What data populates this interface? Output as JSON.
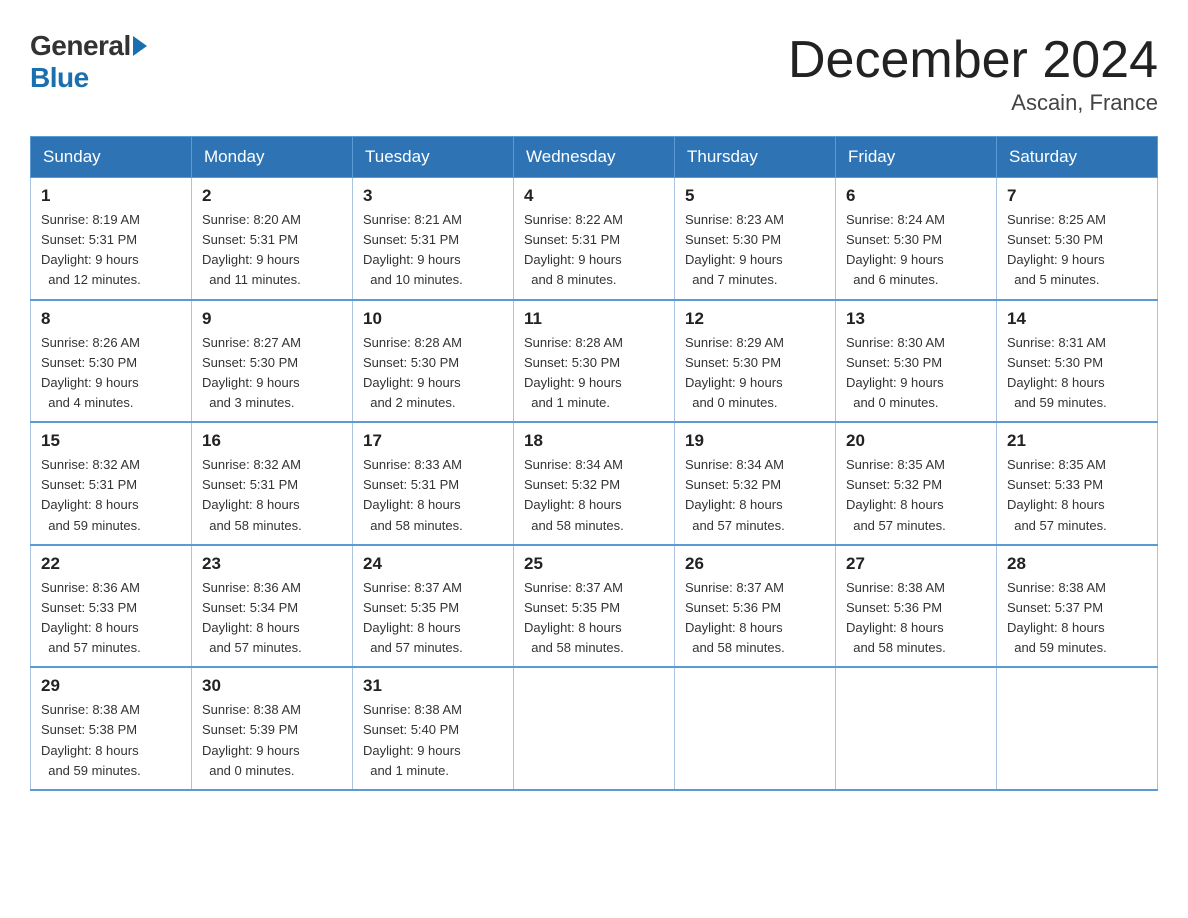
{
  "header": {
    "title": "December 2024",
    "subtitle": "Ascain, France",
    "logo_general": "General",
    "logo_blue": "Blue"
  },
  "days_of_week": [
    "Sunday",
    "Monday",
    "Tuesday",
    "Wednesday",
    "Thursday",
    "Friday",
    "Saturday"
  ],
  "weeks": [
    [
      {
        "day": "1",
        "sunrise": "8:19 AM",
        "sunset": "5:31 PM",
        "daylight": "9 hours and 12 minutes."
      },
      {
        "day": "2",
        "sunrise": "8:20 AM",
        "sunset": "5:31 PM",
        "daylight": "9 hours and 11 minutes."
      },
      {
        "day": "3",
        "sunrise": "8:21 AM",
        "sunset": "5:31 PM",
        "daylight": "9 hours and 10 minutes."
      },
      {
        "day": "4",
        "sunrise": "8:22 AM",
        "sunset": "5:31 PM",
        "daylight": "9 hours and 8 minutes."
      },
      {
        "day": "5",
        "sunrise": "8:23 AM",
        "sunset": "5:30 PM",
        "daylight": "9 hours and 7 minutes."
      },
      {
        "day": "6",
        "sunrise": "8:24 AM",
        "sunset": "5:30 PM",
        "daylight": "9 hours and 6 minutes."
      },
      {
        "day": "7",
        "sunrise": "8:25 AM",
        "sunset": "5:30 PM",
        "daylight": "9 hours and 5 minutes."
      }
    ],
    [
      {
        "day": "8",
        "sunrise": "8:26 AM",
        "sunset": "5:30 PM",
        "daylight": "9 hours and 4 minutes."
      },
      {
        "day": "9",
        "sunrise": "8:27 AM",
        "sunset": "5:30 PM",
        "daylight": "9 hours and 3 minutes."
      },
      {
        "day": "10",
        "sunrise": "8:28 AM",
        "sunset": "5:30 PM",
        "daylight": "9 hours and 2 minutes."
      },
      {
        "day": "11",
        "sunrise": "8:28 AM",
        "sunset": "5:30 PM",
        "daylight": "9 hours and 1 minute."
      },
      {
        "day": "12",
        "sunrise": "8:29 AM",
        "sunset": "5:30 PM",
        "daylight": "9 hours and 0 minutes."
      },
      {
        "day": "13",
        "sunrise": "8:30 AM",
        "sunset": "5:30 PM",
        "daylight": "9 hours and 0 minutes."
      },
      {
        "day": "14",
        "sunrise": "8:31 AM",
        "sunset": "5:30 PM",
        "daylight": "8 hours and 59 minutes."
      }
    ],
    [
      {
        "day": "15",
        "sunrise": "8:32 AM",
        "sunset": "5:31 PM",
        "daylight": "8 hours and 59 minutes."
      },
      {
        "day": "16",
        "sunrise": "8:32 AM",
        "sunset": "5:31 PM",
        "daylight": "8 hours and 58 minutes."
      },
      {
        "day": "17",
        "sunrise": "8:33 AM",
        "sunset": "5:31 PM",
        "daylight": "8 hours and 58 minutes."
      },
      {
        "day": "18",
        "sunrise": "8:34 AM",
        "sunset": "5:32 PM",
        "daylight": "8 hours and 58 minutes."
      },
      {
        "day": "19",
        "sunrise": "8:34 AM",
        "sunset": "5:32 PM",
        "daylight": "8 hours and 57 minutes."
      },
      {
        "day": "20",
        "sunrise": "8:35 AM",
        "sunset": "5:32 PM",
        "daylight": "8 hours and 57 minutes."
      },
      {
        "day": "21",
        "sunrise": "8:35 AM",
        "sunset": "5:33 PM",
        "daylight": "8 hours and 57 minutes."
      }
    ],
    [
      {
        "day": "22",
        "sunrise": "8:36 AM",
        "sunset": "5:33 PM",
        "daylight": "8 hours and 57 minutes."
      },
      {
        "day": "23",
        "sunrise": "8:36 AM",
        "sunset": "5:34 PM",
        "daylight": "8 hours and 57 minutes."
      },
      {
        "day": "24",
        "sunrise": "8:37 AM",
        "sunset": "5:35 PM",
        "daylight": "8 hours and 57 minutes."
      },
      {
        "day": "25",
        "sunrise": "8:37 AM",
        "sunset": "5:35 PM",
        "daylight": "8 hours and 58 minutes."
      },
      {
        "day": "26",
        "sunrise": "8:37 AM",
        "sunset": "5:36 PM",
        "daylight": "8 hours and 58 minutes."
      },
      {
        "day": "27",
        "sunrise": "8:38 AM",
        "sunset": "5:36 PM",
        "daylight": "8 hours and 58 minutes."
      },
      {
        "day": "28",
        "sunrise": "8:38 AM",
        "sunset": "5:37 PM",
        "daylight": "8 hours and 59 minutes."
      }
    ],
    [
      {
        "day": "29",
        "sunrise": "8:38 AM",
        "sunset": "5:38 PM",
        "daylight": "8 hours and 59 minutes."
      },
      {
        "day": "30",
        "sunrise": "8:38 AM",
        "sunset": "5:39 PM",
        "daylight": "9 hours and 0 minutes."
      },
      {
        "day": "31",
        "sunrise": "8:38 AM",
        "sunset": "5:40 PM",
        "daylight": "9 hours and 1 minute."
      },
      null,
      null,
      null,
      null
    ]
  ],
  "labels": {
    "sunrise": "Sunrise:",
    "sunset": "Sunset:",
    "daylight": "Daylight:"
  }
}
